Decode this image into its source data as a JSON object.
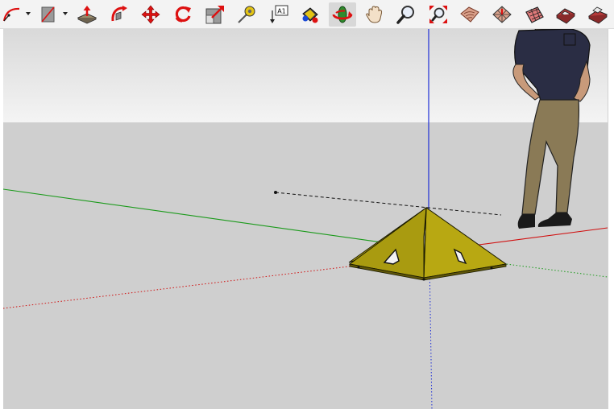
{
  "toolbar": {
    "tools": [
      {
        "name": "arc-tool",
        "icon": "arc-icon",
        "has_dropdown": true
      },
      {
        "name": "rectangle-tool",
        "icon": "rectangle-icon",
        "has_dropdown": true
      },
      {
        "name": "push-pull-tool",
        "icon": "push-pull-icon"
      },
      {
        "name": "follow-me-tool",
        "icon": "follow-me-icon"
      },
      {
        "name": "move-tool",
        "icon": "move-icon"
      },
      {
        "name": "rotate-tool",
        "icon": "rotate-icon"
      },
      {
        "name": "scale-tool",
        "icon": "scale-icon"
      },
      {
        "name": "tape-measure-tool",
        "icon": "tape-measure-icon"
      },
      {
        "name": "text-tool",
        "icon": "text-icon",
        "label": "A1"
      },
      {
        "name": "paint-bucket-tool",
        "icon": "paint-bucket-icon"
      },
      {
        "name": "orbit-tool",
        "icon": "orbit-icon",
        "active": true
      },
      {
        "name": "pan-tool",
        "icon": "pan-hand-icon"
      },
      {
        "name": "zoom-tool",
        "icon": "zoom-icon"
      },
      {
        "name": "zoom-extents-tool",
        "icon": "zoom-extents-icon"
      },
      {
        "name": "sandbox-from-contours-tool",
        "icon": "sandbox-contours-icon"
      },
      {
        "name": "sandbox-from-scratch-tool",
        "icon": "sandbox-scratch-icon"
      },
      {
        "name": "smoove-tool",
        "icon": "smoove-icon"
      },
      {
        "name": "stamp-tool",
        "icon": "stamp-icon"
      },
      {
        "name": "drape-tool",
        "icon": "drape-icon"
      }
    ],
    "text_tool_label": "A1"
  },
  "colors": {
    "sky_top": "#d9d9d9",
    "sky_bottom": "#f4f4f4",
    "ground": "#cfcfcf",
    "axis_red": "#d01010",
    "axis_green": "#1a9a1a",
    "axis_blue": "#1f2fd6",
    "model_face": "#b8a812",
    "model_face_dark": "#8f820b",
    "model_edge": "#1b1b00"
  },
  "scene": {
    "model": "pyramid",
    "scale_figure": "person-standing"
  }
}
